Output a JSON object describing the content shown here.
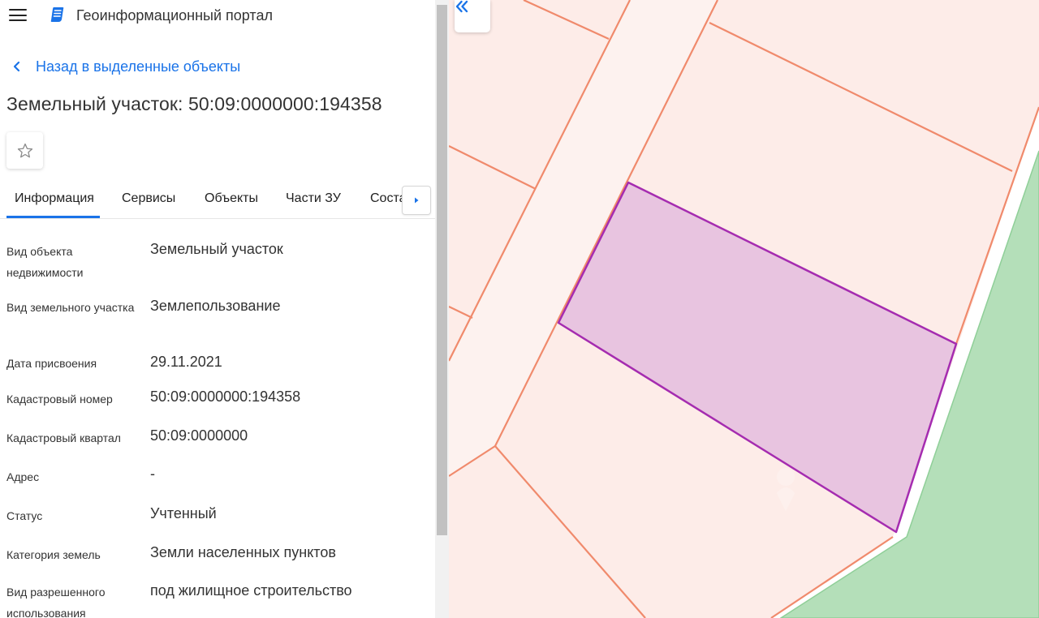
{
  "header": {
    "app_title": "Геоинформационный портал",
    "menu_icon": "hamburger-menu-icon",
    "logo_icon": "portal-logo-icon"
  },
  "back_link": {
    "label": "Назад в выделенные объекты",
    "icon": "chevron-left-icon"
  },
  "object": {
    "title": "Земельный участок: 50:09:0000000:194358",
    "favorite_icon": "star-outline-icon"
  },
  "tabs": [
    {
      "label": "Информация",
      "active": true
    },
    {
      "label": "Сервисы",
      "active": false
    },
    {
      "label": "Объекты",
      "active": false
    },
    {
      "label": "Части ЗУ",
      "active": false
    },
    {
      "label": "Соста",
      "active": false
    }
  ],
  "tab_scroll_icon": "caret-right-icon",
  "info": [
    {
      "label": "Вид объекта недвижимости",
      "value": "Земельный участок"
    },
    {
      "label": "Вид земельного участка",
      "value": "Землепользование"
    },
    {
      "label": "Дата присвоения",
      "value": "29.11.2021"
    },
    {
      "label": "Кадастровый номер",
      "value": "50:09:0000000:194358"
    },
    {
      "label": "Кадастровый квартал",
      "value": "50:09:0000000"
    },
    {
      "label": "Адрес",
      "value": "-"
    },
    {
      "label": "Статус",
      "value": "Учтенный"
    },
    {
      "label": "Категория земель",
      "value": "Земли населенных пунктов"
    },
    {
      "label": "Вид разрешенного использования",
      "value": "под жилищное строительство"
    }
  ],
  "map": {
    "collapse_icon": "double-chevron-left-icon",
    "colors": {
      "parcel_fill": "#fdece8",
      "parcel_border": "#f08a6c",
      "selected_fill": "#e8c4e0",
      "selected_border": "#a52cb0",
      "green_zone": "#b4dfb9",
      "green_border": "#8fcf98"
    }
  }
}
